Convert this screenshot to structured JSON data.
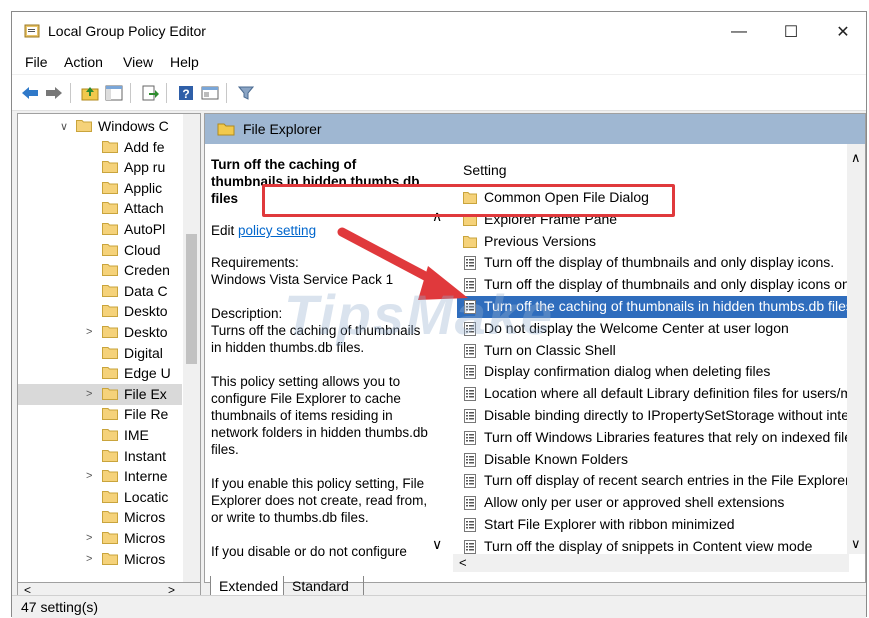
{
  "window": {
    "title": "Local Group Policy Editor",
    "controls": {
      "minimize": "—",
      "maximize": "☐",
      "close": "✕"
    }
  },
  "menu": [
    "File",
    "Action",
    "View",
    "Help"
  ],
  "toolbar": {
    "icons": [
      "back-arrow-icon",
      "forward-arrow-icon",
      "up-folder-icon",
      "show-hide-tree-icon",
      "export-list-icon",
      "help-icon",
      "properties-icon",
      "filter-icon"
    ]
  },
  "tree": {
    "items": [
      {
        "label": "Windows Components",
        "chevron": "∨",
        "expanded": true,
        "indent": 1
      },
      {
        "label": "Add features",
        "chevron": "",
        "indent": 2
      },
      {
        "label": "App runtime",
        "chevron": "",
        "indent": 2
      },
      {
        "label": "Application",
        "chevron": "",
        "indent": 2
      },
      {
        "label": "Attachment",
        "chevron": "",
        "indent": 2
      },
      {
        "label": "AutoPlay",
        "chevron": "",
        "indent": 2
      },
      {
        "label": "Cloud",
        "chevron": "",
        "indent": 2
      },
      {
        "label": "Credential",
        "chevron": "",
        "indent": 2
      },
      {
        "label": "Data Collection",
        "chevron": "",
        "indent": 2
      },
      {
        "label": "Desktop",
        "chevron": "",
        "indent": 2
      },
      {
        "label": "Desktop",
        "chevron": ">",
        "indent": 2
      },
      {
        "label": "Digital",
        "chevron": "",
        "indent": 2
      },
      {
        "label": "Edge UI",
        "chevron": "",
        "indent": 2
      },
      {
        "label": "File Explorer",
        "chevron": ">",
        "indent": 2,
        "selected": true
      },
      {
        "label": "File Revocation",
        "chevron": "",
        "indent": 2
      },
      {
        "label": "IME",
        "chevron": "",
        "indent": 2
      },
      {
        "label": "Instant",
        "chevron": "",
        "indent": 2
      },
      {
        "label": "Internet",
        "chevron": ">",
        "indent": 2
      },
      {
        "label": "Location",
        "chevron": "",
        "indent": 2
      },
      {
        "label": "Microsoft",
        "chevron": "",
        "indent": 2
      },
      {
        "label": "Microsoft",
        "chevron": ">",
        "indent": 2
      },
      {
        "label": "Microsoft",
        "chevron": ">",
        "indent": 2
      }
    ],
    "visible_labels": [
      "Windows C",
      "Add fe",
      "App ru",
      "Applic",
      "Attach",
      "AutoPl",
      "Cloud",
      "Creden",
      "Data C",
      "Deskto",
      "Deskto",
      "Digital",
      "Edge U",
      "File Ex",
      "File Re",
      "IME",
      "Instant",
      "Interne",
      "Locatic",
      "Micros",
      "Micros",
      "Micros"
    ]
  },
  "pane": {
    "header": "File Explorer",
    "description": {
      "title": "Turn off the caching of thumbnails in hidden thumbs.db files",
      "edit_prefix": "Edit",
      "edit_link": "policy setting",
      "requirements_label": "Requirements:",
      "requirements_value": "Windows Vista Service Pack 1",
      "description_label": "Description:",
      "para1": "Turns off the caching of thumbnails in hidden thumbs.db files.",
      "para2": "This policy setting allows you to configure File Explorer to cache thumbnails of items residing in network folders in hidden thumbs.db files.",
      "para3": "If you enable this policy setting, File Explorer does not create, read from, or write to thumbs.db files.",
      "para4": "If you disable or do not configure"
    },
    "list_header": "Setting",
    "settings": [
      {
        "type": "folder",
        "label": "Common Open File Dialog"
      },
      {
        "type": "folder",
        "label": "Explorer Frame Pane"
      },
      {
        "type": "folder",
        "label": "Previous Versions"
      },
      {
        "type": "policy",
        "label": "Turn off the display of thumbnails and only display icons."
      },
      {
        "type": "policy",
        "label": "Turn off the display of thumbnails and only display icons on..."
      },
      {
        "type": "policy",
        "label": "Turn off the caching of thumbnails in hidden thumbs.db files",
        "selected": true
      },
      {
        "type": "policy",
        "label": "Do not display the Welcome Center at user logon"
      },
      {
        "type": "policy",
        "label": "Turn on Classic Shell"
      },
      {
        "type": "policy",
        "label": "Display confirmation dialog when deleting files"
      },
      {
        "type": "policy",
        "label": "Location where all default Library definition files for users/m..."
      },
      {
        "type": "policy",
        "label": "Disable binding directly to IPropertySetStorage without inter..."
      },
      {
        "type": "policy",
        "label": "Turn off Windows Libraries features that rely on indexed file ..."
      },
      {
        "type": "policy",
        "label": "Disable Known Folders"
      },
      {
        "type": "policy",
        "label": "Turn off display of recent search entries in the File Explorer s..."
      },
      {
        "type": "policy",
        "label": "Allow only per user or approved shell extensions"
      },
      {
        "type": "policy",
        "label": "Start File Explorer with ribbon minimized"
      },
      {
        "type": "policy",
        "label": "Turn off the display of snippets in Content view mode"
      }
    ]
  },
  "tabs": [
    "Extended",
    "Standard"
  ],
  "status": "47 setting(s)",
  "watermark": "TipsMake",
  "colors": {
    "highlight": "#2f6dbd",
    "header": "#9fb7d2",
    "callout": "#e0393c"
  }
}
